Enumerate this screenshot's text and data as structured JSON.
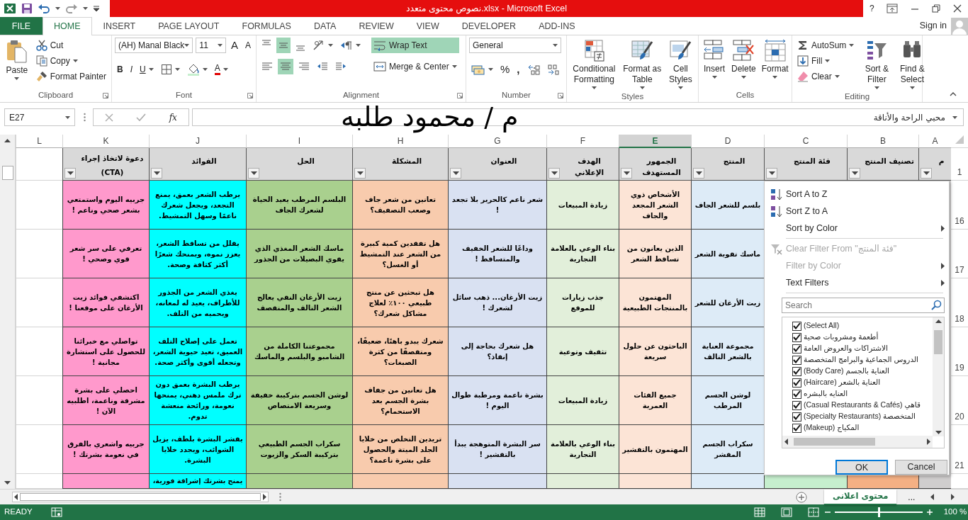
{
  "window": {
    "title": "نصوص محتوى متعدد.xlsx - Microsoft Excel",
    "help": "?"
  },
  "ribbon_tabs": [
    {
      "label": "ADD-INS",
      "kind": "tab",
      "selected": false
    },
    {
      "label": "DEVELOPER",
      "kind": "tab",
      "selected": false
    },
    {
      "label": "VIEW",
      "kind": "tab",
      "selected": false
    },
    {
      "label": "REVIEW",
      "kind": "tab",
      "selected": false
    },
    {
      "label": "DATA",
      "kind": "tab",
      "selected": false
    },
    {
      "label": "FORMULAS",
      "kind": "tab",
      "selected": false
    },
    {
      "label": "PAGE LAYOUT",
      "kind": "tab",
      "selected": false
    },
    {
      "label": "INSERT",
      "kind": "tab",
      "selected": false
    },
    {
      "label": "HOME",
      "kind": "tab",
      "selected": true
    },
    {
      "label": "FILE",
      "kind": "file",
      "selected": false
    }
  ],
  "account": {
    "label": "Sign in"
  },
  "ribbon": {
    "clipboard": {
      "title": "Clipboard",
      "paste": "Paste",
      "cut": "Cut",
      "copy": "Copy",
      "format_painter": "Format Painter"
    },
    "font": {
      "title": "Font",
      "family": "(AH) Manal Black",
      "size": "11",
      "grow": "A",
      "shrink": "A",
      "bold": "B",
      "italic": "I",
      "underline": "U",
      "font_color_label": "A"
    },
    "alignment": {
      "title": "Alignment",
      "vertical": [
        {
          "kind": "top",
          "selected": false
        },
        {
          "kind": "middle",
          "selected": true
        },
        {
          "kind": "bottom",
          "selected": false
        }
      ],
      "horizontal": [
        {
          "kind": "left",
          "selected": false
        },
        {
          "kind": "center",
          "selected": true
        },
        {
          "kind": "right",
          "selected": false
        }
      ],
      "wrap_text": {
        "label": "Wrap Text",
        "on": true
      },
      "merge": "Merge & Center"
    },
    "number": {
      "title": "Number",
      "format": "General",
      "percent": "%",
      "comma": ","
    },
    "styles": {
      "title": "Styles",
      "buttons": [
        {
          "kind": "cell",
          "label": "Cell Styles"
        },
        {
          "kind": "table",
          "label": "Format as Table"
        },
        {
          "kind": "conditional",
          "label": "Conditional Formatting"
        }
      ]
    },
    "cells": {
      "title": "Cells",
      "buttons": [
        {
          "kind": "format",
          "label": "Format"
        },
        {
          "kind": "delete",
          "label": "Delete"
        },
        {
          "kind": "insert",
          "label": "Insert"
        }
      ]
    },
    "editing": {
      "title": "Editing",
      "small": [
        {
          "kind": "autosum",
          "label": "AutoSum"
        },
        {
          "kind": "fill",
          "label": "Fill"
        },
        {
          "kind": "clear",
          "label": "Clear"
        }
      ],
      "large": [
        {
          "kind": "find",
          "label": "Find & Select"
        },
        {
          "kind": "sort",
          "label": "Sort & Filter"
        }
      ]
    }
  },
  "formula_bar": {
    "name_box": "E27",
    "fx": "fx",
    "value": "محبي الراحة والأناقة"
  },
  "overlay_text": "م / محمود طلبه",
  "sheet": {
    "columns": [
      {
        "letter": "A",
        "header": "م",
        "selected": false,
        "color": "#d0cece"
      },
      {
        "letter": "B",
        "header": "تصنيف المنتج",
        "selected": false,
        "color": "#f4b084"
      },
      {
        "letter": "C",
        "header": "فئة المنتج",
        "selected": false,
        "color": "#c6efce"
      },
      {
        "letter": "D",
        "header": "المنتج",
        "selected": false,
        "color": "#ddebf7"
      },
      {
        "letter": "E",
        "header": "الجمهور المستهدف",
        "selected": true,
        "color": "#fce4d6"
      },
      {
        "letter": "F",
        "header": "الهدف الإعلاني",
        "selected": false,
        "color": "#e2efda"
      },
      {
        "letter": "G",
        "header": "العنوان",
        "selected": false,
        "color": "#d9e1f2"
      },
      {
        "letter": "H",
        "header": "المشكلة",
        "selected": false,
        "color": "#f8cbad"
      },
      {
        "letter": "I",
        "header": "الحل",
        "selected": false,
        "color": "#a9d08e"
      },
      {
        "letter": "J",
        "header": "الفوائد",
        "selected": false,
        "color": "#00ffff"
      },
      {
        "letter": "K",
        "header": "دعوة لاتخاذ إجراء (CTA)",
        "selected": false,
        "color": "#ff99cc"
      },
      {
        "letter": "L",
        "selected": false
      }
    ],
    "header_row": "1",
    "rows": [
      {
        "number": "16",
        "cells": {
          "D": "بلسم للشعر الجاف",
          "E": "الأشخاص ذوي الشعر المجعد والجاف",
          "F": "زيادة المبيعات",
          "G": "شعر ناعم كالحرير بلا تجعد !",
          "H": "تعانين من شعر جاف وصعب التصفيف؟",
          "I": "البلسم المرطب يعيد الحياة لشعرك الجاف",
          "J": "يرطب الشعر بعمق، يمنع التجعد، ويجعل شعرك ناعمًا وسهل التمشيط.",
          "K": "جربيه اليوم واستمتعي بشعر صحي وناعم !"
        }
      },
      {
        "number": "17",
        "cells": {
          "D": "ماسك تقوية الشعر",
          "E": "الذين يعانون من تساقط الشعر",
          "F": "بناء الوعي بالعلامة التجارية",
          "G": "وداعًا للشعر الخفيف والمتساقط !",
          "H": "هل تفقدين كمية كبيرة من الشعر عند التمشيط أو الغسل؟",
          "I": "ماسك الشعر المغذي الذي يقوي البصيلات من الجذور",
          "J": "يقلل من تساقط الشعر، يعزز نموه، ويمنحك شعرًا أكثر كثافة وصحة.",
          "K": "تعرفي على سر شعر قوي وصحي !"
        }
      },
      {
        "number": "18",
        "cells": {
          "D": "زيت الأرغان للشعر",
          "E": "المهتمون بالمنتجات الطبيعية",
          "F": "جذب زيارات للموقع",
          "G": "زيت الأرغان... ذهب سائل لشعرك !",
          "H": "هل تبحثين عن منتج طبيعي ١٠٠٪ لعلاج مشاكل شعرك؟",
          "I": "زيت الأرغان النقي يعالج الشعر التالف والمتقصف",
          "J": "يغذي الشعر من الجذور للأطراف، يعيد له لمعانه، ويحميه من التلف.",
          "K": "اكتشفي فوائد زيت الأرغان على موقعنا !"
        }
      },
      {
        "number": "19",
        "cells": {
          "D": "مجموعة العناية بالشعر التالف",
          "E": "الباحثون عن حلول سريعة",
          "F": "تثقيف وتوعية",
          "G": "هل شعرك بحاجة إلى إنقاذ؟",
          "H": "شعرك يبدو باهتًا، ضعيفًا، ومتقصفًا من كثرة الصبغات؟",
          "I": "مجموعتنا الكاملة من الشامبو والبلسم والماسك",
          "J": "تعمل على إصلاح التلف العميق، تعيد حيوية الشعر، وتجعله أقوى وأكثر صحة.",
          "K": "تواصلي مع خبرائنا للحصول على استشارة مجانية !"
        }
      },
      {
        "number": "20",
        "cells": {
          "D": "لوشن الجسم المرطب",
          "E": "جميع الفئات العمرية",
          "F": "زيادة المبيعات",
          "G": "بشرة ناعمة ومرطبة طوال اليوم !",
          "H": "هل تعانين من جفاف بشرة الجسم بعد الاستحمام؟",
          "I": "لوشن الجسم بتركيبة خفيفة وسريعة الامتصاص",
          "J": "يرطب البشرة بعمق دون ترك ملمس دهني، يمنحها نعومة، ورائحة منعشة تدوم.",
          "K": "احصلي على بشرة مشرقة وناعمة، اطلبيه الآن !"
        }
      },
      {
        "number": "21",
        "cells": {
          "D": "سكراب الجسم المقشر",
          "E": "المهتمون بالتقشير",
          "F": "بناء الوعي بالعلامة التجارية",
          "G": "سر البشرة المتوهجة يبدأ بالتقشير !",
          "H": "تريدين التخلص من خلايا الجلد الميتة والحصول على بشرة ناعمة؟",
          "I": "سكراب الجسم الطبيعي بتركيبة السكر والزيوت",
          "J": "يقشر البشرة بلطف، يزيل الشوائب، ويجدد خلايا البشرة.",
          "K": "جربيه واشعري بالفرق في نعومة بشرتك !"
        }
      },
      {
        "cells": {
          "J": "يمنح بشرتك إشراقة فورية،"
        }
      }
    ]
  },
  "filter_menu": {
    "items": [
      {
        "kind": "sort_az",
        "label": "Sort A to Z",
        "disabled": false,
        "submenu": false
      },
      {
        "kind": "sort_za",
        "label": "Sort Z to A",
        "disabled": false,
        "submenu": false
      },
      {
        "kind": "plain",
        "label": "Sort by Color",
        "disabled": false,
        "submenu": true
      },
      {
        "kind": "clear",
        "label": "Clear Filter From \"فئة المنتج\"",
        "disabled": true,
        "submenu": false
      },
      {
        "kind": "plain",
        "label": "Filter by Color",
        "disabled": true,
        "submenu": true
      },
      {
        "kind": "plain",
        "label": "Text Filters",
        "disabled": false,
        "submenu": true
      }
    ],
    "search": {
      "placeholder": "Search"
    },
    "values": [
      {
        "label": "(Select All)",
        "checked": true
      },
      {
        "label": "أطعمة ومشروبات صحية",
        "checked": true
      },
      {
        "label": "الاشتراكات والعروض العامة",
        "checked": true
      },
      {
        "label": "الدروس الجماعية والبرامج المتخصصة",
        "checked": true
      },
      {
        "label": "(Body Care) العناية بالجسم",
        "checked": true
      },
      {
        "label": "(Haircare) العناية بالشعر",
        "checked": true
      },
      {
        "label": "العنايه بالبشره",
        "checked": true
      },
      {
        "label": "(Casual Restaurants & Cafés) قاهي",
        "checked": true
      },
      {
        "label": "(Specialty Restaurants) المتخصصة",
        "checked": true
      },
      {
        "label": "(Makeup) المكياج",
        "checked": true
      }
    ],
    "buttons": [
      {
        "label": "Cancel",
        "focused": false
      },
      {
        "label": "OK",
        "focused": true
      }
    ]
  },
  "sheet_tabs": {
    "more": "...",
    "tabs": [
      {
        "label": "محتوى اعلانى",
        "selected": true
      }
    ]
  },
  "status_bar": {
    "mode": "READY",
    "zoom": "100 %",
    "level": 0.5
  }
}
